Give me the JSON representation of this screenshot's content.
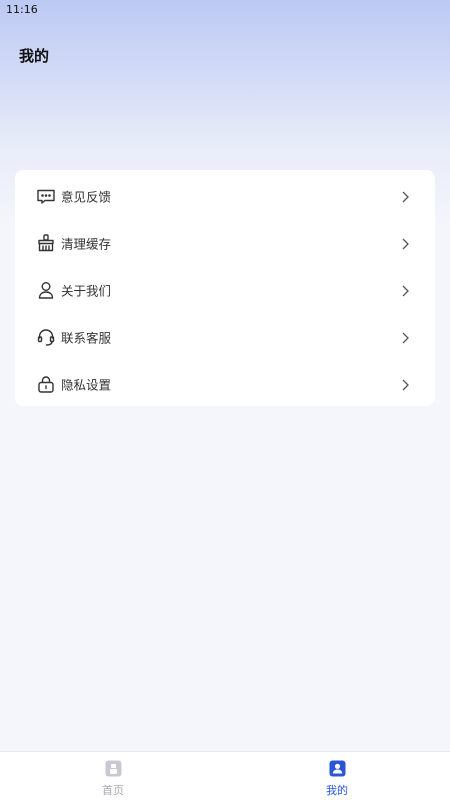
{
  "status_bar": {
    "time": "11:16"
  },
  "header": {
    "title": "我的"
  },
  "menu": {
    "items": [
      {
        "label": "意见反馈",
        "icon": "feedback-icon"
      },
      {
        "label": "清理缓存",
        "icon": "broom-icon"
      },
      {
        "label": "关于我们",
        "icon": "user-icon"
      },
      {
        "label": "联系客服",
        "icon": "headset-icon"
      },
      {
        "label": "隐私设置",
        "icon": "lock-icon"
      }
    ]
  },
  "bottom_nav": {
    "tabs": [
      {
        "label": "首页",
        "icon": "home-icon",
        "active": false
      },
      {
        "label": "我的",
        "icon": "profile-icon",
        "active": true
      }
    ],
    "active_color": "#2a56d6",
    "inactive_color": "#a7abb3"
  }
}
